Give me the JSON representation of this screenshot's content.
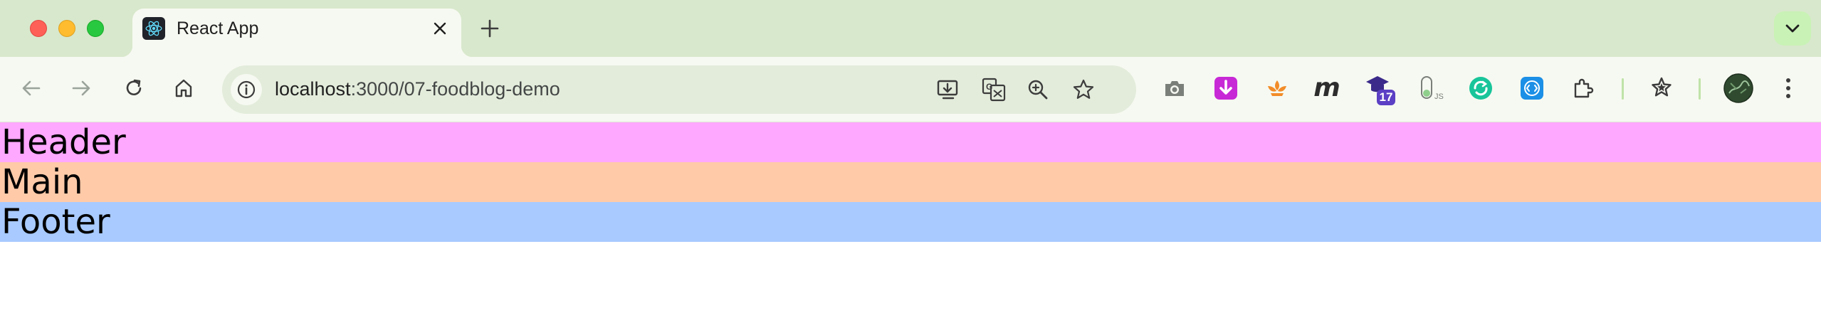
{
  "browser": {
    "tab": {
      "title": "React App",
      "favicon": "react-logo-icon"
    },
    "address_bar": {
      "host": "localhost",
      "path": ":3000/07-foodblog-demo"
    },
    "extension_badge": "17",
    "extension_label": "JS"
  },
  "page": {
    "header": "Header",
    "main": "Main",
    "footer": "Footer"
  },
  "colors": {
    "header_bg": "#ffa8ff",
    "main_bg": "#ffcaa8",
    "footer_bg": "#a8caff",
    "chrome_frame": "#d8e8cc",
    "chrome_toolbar": "#f6f9f1"
  }
}
